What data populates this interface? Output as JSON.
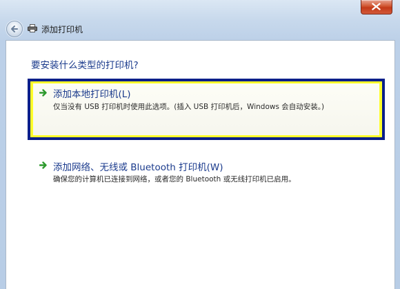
{
  "header": {
    "title": "添加打印机"
  },
  "main": {
    "question": "要安装什么类型的打印机?",
    "options": [
      {
        "title": "添加本地打印机(L)",
        "description": "仅当没有 USB 打印机时使用此选项。(插入 USB 打印机后，Windows 会自动安装。)"
      },
      {
        "title": "添加网络、无线或 Bluetooth 打印机(W)",
        "description": "确保您的计算机已连接到网络，或者您的 Bluetooth 或无线打印机已启用。"
      }
    ]
  },
  "icons": {
    "back": "back-arrow-icon",
    "printer": "printer-icon",
    "close": "close-icon",
    "option_arrow": "green-arrow-icon"
  },
  "colors": {
    "accent_text": "#1a3a8c",
    "selection_outer": "#0a1f8a",
    "selection_inner": "#ffff2b",
    "close_button": "#c33a18",
    "arrow_green": "#2e9a2e"
  }
}
